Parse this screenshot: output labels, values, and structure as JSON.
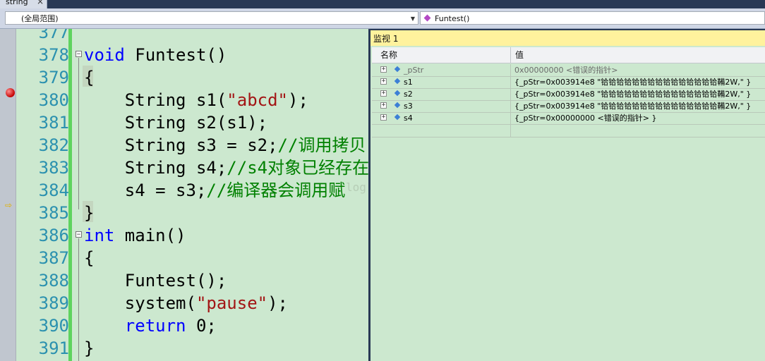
{
  "tab": {
    "title": "string",
    "close": "×"
  },
  "nav": {
    "scope": "(全局范围)",
    "function": "Funtest()"
  },
  "editor": {
    "lines": [
      {
        "num": "377"
      },
      {
        "num": "378",
        "parts": [
          [
            "kw",
            "void"
          ],
          [
            "",
            " Funtest()"
          ]
        ]
      },
      {
        "num": "379",
        "parts": [
          [
            "",
            "{"
          ]
        ]
      },
      {
        "num": "380",
        "parts": [
          [
            "",
            "    String s1("
          ],
          [
            "str",
            "\"abcd\""
          ],
          [
            "",
            ");"
          ]
        ]
      },
      {
        "num": "381",
        "parts": [
          [
            "",
            "    String s2(s1);"
          ]
        ]
      },
      {
        "num": "382",
        "parts": [
          [
            "",
            "    String s3 = s2;"
          ],
          [
            "cm",
            "//调用拷贝"
          ]
        ]
      },
      {
        "num": "383",
        "parts": [
          [
            "",
            "    String s4;"
          ],
          [
            "cm",
            "//s4对象已经存在"
          ]
        ]
      },
      {
        "num": "384",
        "parts": [
          [
            "",
            "    s4 = s3;"
          ],
          [
            "cm",
            "//编译器会调用赋"
          ]
        ]
      },
      {
        "num": "385",
        "parts": [
          [
            "",
            "}"
          ]
        ]
      },
      {
        "num": "386",
        "parts": [
          [
            "kw",
            "int"
          ],
          [
            "",
            " main()"
          ]
        ]
      },
      {
        "num": "387",
        "parts": [
          [
            "",
            "{"
          ]
        ]
      },
      {
        "num": "388",
        "parts": [
          [
            "",
            "    Funtest();"
          ]
        ]
      },
      {
        "num": "389",
        "parts": [
          [
            "",
            "    system("
          ],
          [
            "str",
            "\"pause\""
          ],
          [
            "",
            ");"
          ]
        ]
      },
      {
        "num": "390",
        "parts": [
          [
            "",
            "    "
          ],
          [
            "kw",
            "return"
          ],
          [
            "",
            " 0;"
          ]
        ]
      },
      {
        "num": "391",
        "parts": [
          [
            "",
            "}"
          ]
        ]
      }
    ],
    "watermark": "log.csdn.net/"
  },
  "watch": {
    "title": "监视 1",
    "col_name": "名称",
    "col_value": "值",
    "rows": [
      {
        "name": "_pStr",
        "value": "0x00000000 <错误的指针>",
        "icon": "pointer-icon",
        "gray": true
      },
      {
        "name": "s1",
        "value": "{_pStr=0x003914e8 \"铪铪铪铪铪铪铪铪铪铪铪铪铪铪铪鞴2W,\" }",
        "icon": "object-icon"
      },
      {
        "name": "s2",
        "value": "{_pStr=0x003914e8 \"铪铪铪铪铪铪铪铪铪铪铪铪铪铪铪鞴2W,\" }",
        "icon": "object-icon"
      },
      {
        "name": "s3",
        "value": "{_pStr=0x003914e8 \"铪铪铪铪铪铪铪铪铪铪铪铪铪铪铪鞴2W,\" }",
        "icon": "object-icon"
      },
      {
        "name": "s4",
        "value": "{_pStr=0x00000000 <错误的指针> }",
        "icon": "object-icon"
      }
    ]
  },
  "colors": {
    "editor_bg": "#cce8cf",
    "line_number": "#2b91af",
    "keyword": "#0000ff",
    "string": "#a31515",
    "comment": "#008000",
    "watch_title_bg": "#fff29d"
  }
}
